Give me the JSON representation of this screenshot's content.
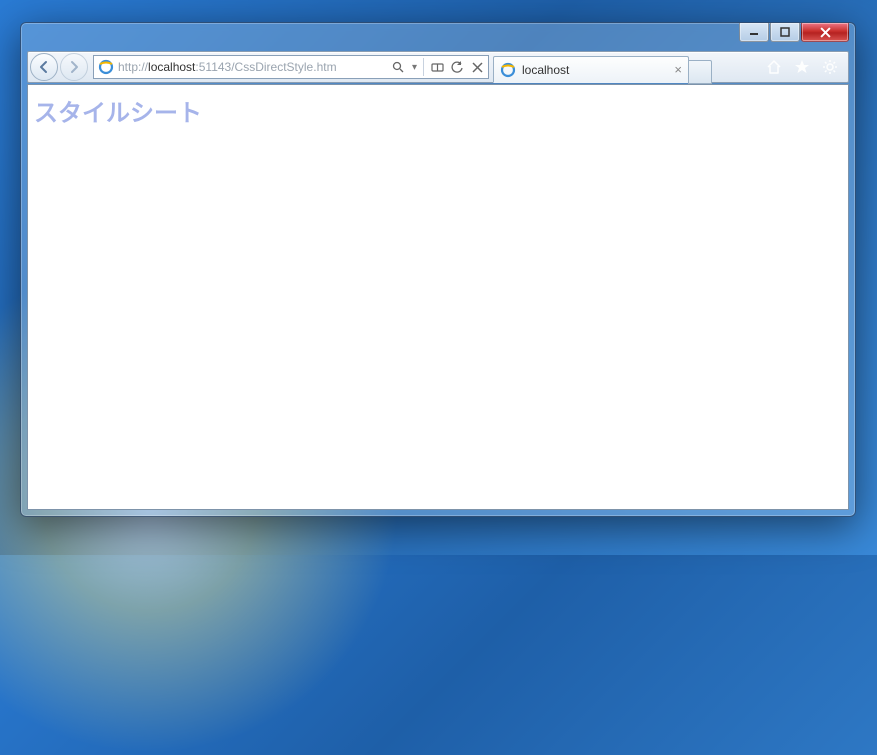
{
  "address": {
    "scheme": "http://",
    "host": "localhost",
    "rest": ":51143/CssDirectStyle.htm"
  },
  "tab": {
    "title": "localhost"
  },
  "page": {
    "heading": "スタイルシート"
  },
  "icons": {
    "back": "back-arrow",
    "forward": "forward-arrow",
    "ie": "ie-logo",
    "search": "magnifier",
    "compat": "compat-view",
    "refresh": "refresh",
    "stop": "stop",
    "close_tab": "×",
    "home": "home",
    "favorites": "star",
    "tools": "gear",
    "minimize": "minimize",
    "maximize": "maximize",
    "close": "close"
  }
}
